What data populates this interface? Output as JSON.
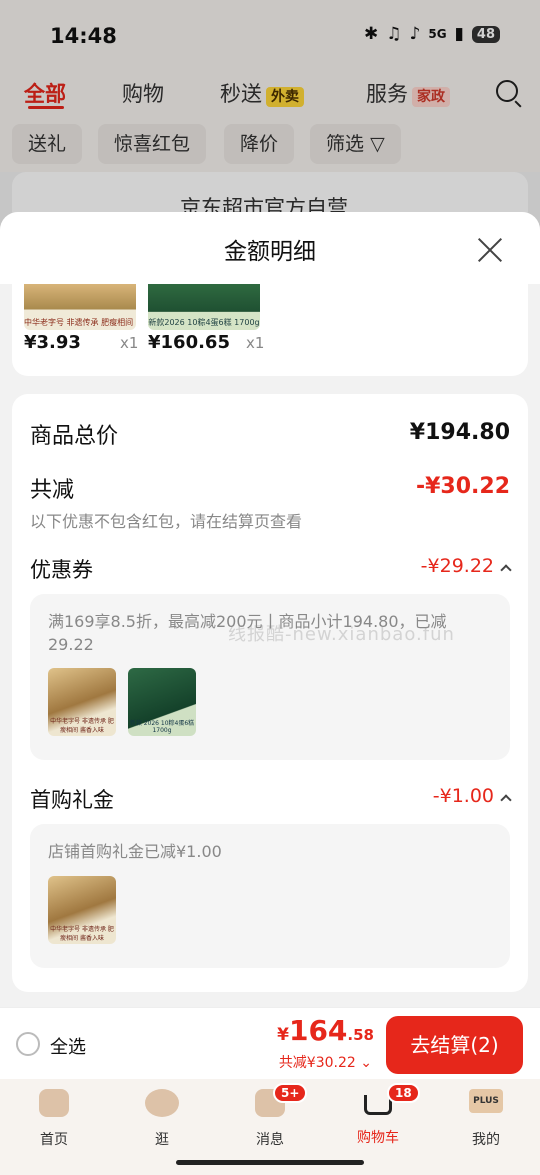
{
  "status_bar": {
    "time": "14:48",
    "network": "5G",
    "battery": "48"
  },
  "top_tabs": [
    {
      "label": "全部",
      "badge": ""
    },
    {
      "label": "购物",
      "badge": ""
    },
    {
      "label": "秒送",
      "badge": "外卖"
    },
    {
      "label": "服务",
      "badge": "家政"
    }
  ],
  "filter_chips": [
    "送礼",
    "惊喜红包",
    "降价",
    "筛选"
  ],
  "behind_card": {
    "store": "京东超市官方自营"
  },
  "sheet": {
    "title": "金额明细",
    "products": [
      {
        "price": "¥3.93",
        "qty": "x1",
        "caption": "中华老字号 非遗传承 肥瘦相间 酱香入味"
      },
      {
        "price": "¥160.65",
        "qty": "x1",
        "caption": "新款2026 10粽4蛋6糕 1700g"
      }
    ],
    "total_label": "商品总价",
    "total_value": "¥194.80",
    "reduce_label": "共减",
    "reduce_value": "-¥30.22",
    "reduce_note": "以下优惠不包含红包，请在结算页查看",
    "coupon_label": "优惠券",
    "coupon_value": "-¥29.22",
    "coupon_desc": "满169享8.5折，最高减200元丨商品小计194.80，已减29.22",
    "gift_label": "首购礼金",
    "gift_value": "-¥1.00",
    "gift_desc": "店铺首购礼金已减¥1.00",
    "mini_captions": [
      "中华老字号 非遗传承 肥瘦相间 酱香入味",
      "新款 2026 10粽4蛋6糕 1700g"
    ],
    "watermark": "线报酷-new.xianbao.fun"
  },
  "checkout": {
    "select_all": "全选",
    "yen": "¥",
    "total_int": "164",
    "total_dec": ".58",
    "discount": "共减¥30.22",
    "pay_button": "去结算(2)"
  },
  "bottom_nav": [
    {
      "label": "首页",
      "badge": "",
      "icon": "home-icon"
    },
    {
      "label": "逛",
      "badge": "",
      "icon": "browse-icon"
    },
    {
      "label": "消息",
      "badge": "5+",
      "icon": "message-icon"
    },
    {
      "label": "购物车",
      "badge": "18",
      "icon": "cart-icon"
    },
    {
      "label": "我的",
      "badge": "",
      "icon": "plus-icon",
      "icon_text": "PLUS"
    }
  ],
  "colors": {
    "accent": "#e6271b",
    "sheet_bg": "#f2f2f2"
  }
}
